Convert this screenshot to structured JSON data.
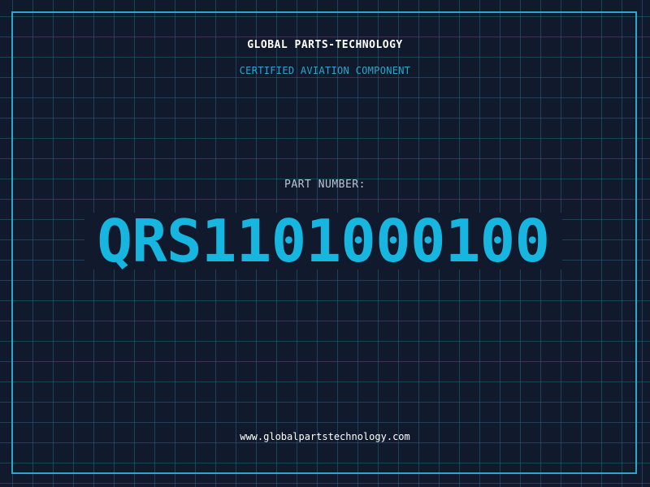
{
  "header": {
    "company": "GLOBAL PARTS-TECHNOLOGY",
    "tagline": "CERTIFIED AVIATION COMPONENT"
  },
  "part": {
    "label": "PART NUMBER:",
    "number": "QRS1101000100"
  },
  "footer": {
    "website": "www.globalpartstechnology.com"
  },
  "colors": {
    "background": "#111a2c",
    "grid": "#256380",
    "accent": "#2aa6cf",
    "part_number": "#16b6e0",
    "text": "#ffffff"
  }
}
